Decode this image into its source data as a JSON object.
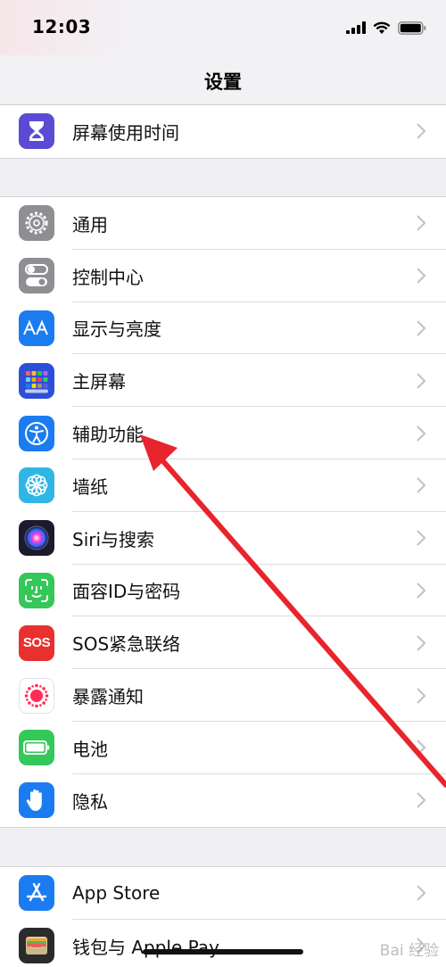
{
  "status_bar": {
    "time": "12:03"
  },
  "nav": {
    "title": "设置"
  },
  "group_top": [
    {
      "label": "屏幕使用时间",
      "icon": "hourglass-icon",
      "color": "#5b4bd4"
    }
  ],
  "group_main": [
    {
      "label": "通用",
      "icon": "gear-icon",
      "color": "#8e8e93"
    },
    {
      "label": "控制中心",
      "icon": "toggles-icon",
      "color": "#8e8e93"
    },
    {
      "label": "显示与亮度",
      "icon": "text-size-icon",
      "color": "#1a7cf0"
    },
    {
      "label": "主屏幕",
      "icon": "app-grid-icon",
      "color": "#2d4fd6"
    },
    {
      "label": "辅助功能",
      "icon": "accessibility-icon",
      "color": "#1a7cf0"
    },
    {
      "label": "墙纸",
      "icon": "flower-icon",
      "color": "#2fb6e6"
    },
    {
      "label": "Siri与搜索",
      "icon": "siri-icon",
      "color": "#1b1b2e"
    },
    {
      "label": "面容ID与密码",
      "icon": "face-id-icon",
      "color": "#34c759"
    },
    {
      "label": "SOS紧急联络",
      "icon": "sos-icon",
      "color": "#e8312f"
    },
    {
      "label": "暴露通知",
      "icon": "exposure-icon",
      "color": "#ffffff"
    },
    {
      "label": "电池",
      "icon": "battery-icon",
      "color": "#34c759"
    },
    {
      "label": "隐私",
      "icon": "hand-icon",
      "color": "#1a7cf0"
    }
  ],
  "group_store": [
    {
      "label": "App Store",
      "icon": "app-store-icon",
      "color": "#1a7cf0"
    },
    {
      "label": "钱包与 Apple Pay",
      "icon": "wallet-icon",
      "color": "#2b2b2b"
    }
  ],
  "icons": {
    "sos_text": "SOS"
  },
  "annotation": {
    "color": "#e8242c",
    "target": "辅助功能"
  },
  "watermark": {
    "text": "Bai 经验"
  }
}
